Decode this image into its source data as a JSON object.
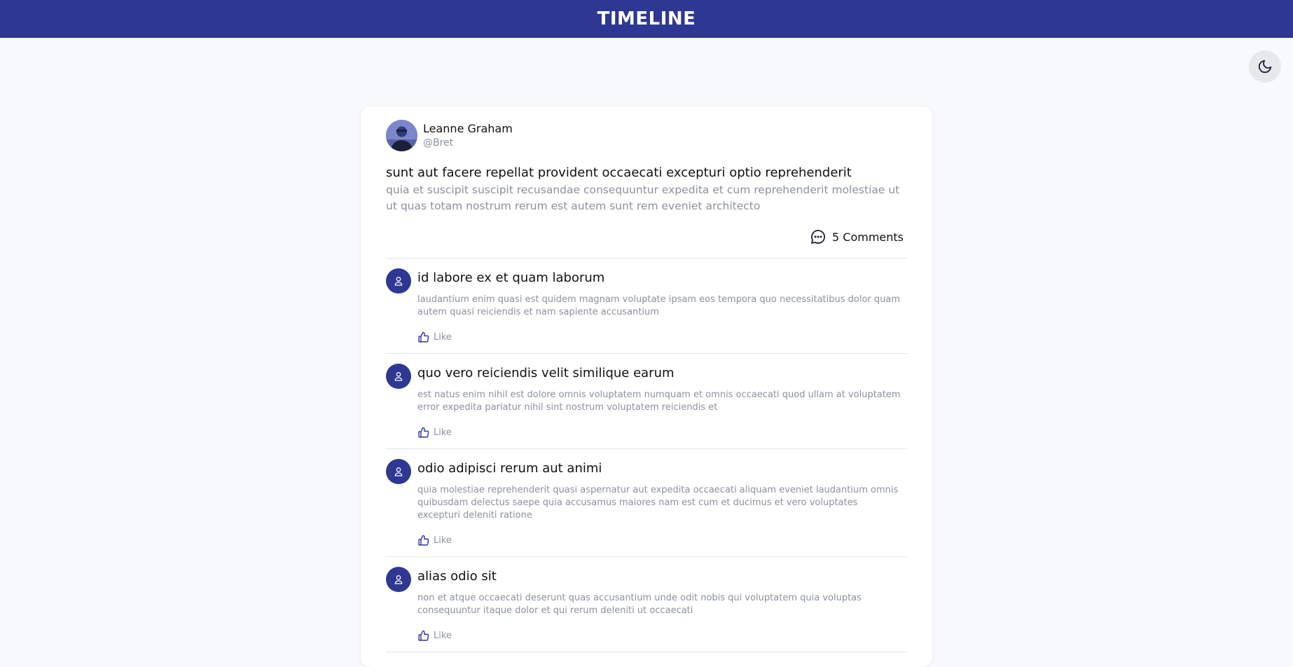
{
  "header": {
    "title": "TIMELINE"
  },
  "theme_toggle": {
    "icon": "moon-icon"
  },
  "post": {
    "author": {
      "name": "Leanne Graham",
      "handle": "@Bret"
    },
    "title": "sunt aut facere repellat provident occaecati excepturi optio reprehenderit",
    "body": "quia et suscipit suscipit recusandae consequuntur expedita et cum reprehenderit molestiae ut ut quas totam nostrum rerum est autem sunt rem eveniet architecto",
    "comments_label": "5 Comments"
  },
  "comments": [
    {
      "title": "id labore ex et quam laborum",
      "body": "laudantium enim quasi est quidem magnam voluptate ipsam eos tempora quo necessitatibus dolor quam autem quasi reiciendis et nam sapiente accusantium",
      "like_label": "Like"
    },
    {
      "title": "quo vero reiciendis velit similique earum",
      "body": "est natus enim nihil est dolore omnis voluptatem numquam et omnis occaecati quod ullam at voluptatem error expedita pariatur nihil sint nostrum voluptatem reiciendis et",
      "like_label": "Like"
    },
    {
      "title": "odio adipisci rerum aut animi",
      "body": "quia molestiae reprehenderit quasi aspernatur aut expedita occaecati aliquam eveniet laudantium omnis quibusdam delectus saepe quia accusamus maiores nam est cum et ducimus et vero voluptates excepturi deleniti ratione",
      "like_label": "Like"
    },
    {
      "title": "alias odio sit",
      "body": "non et atque occaecati deserunt quas accusantium unde odit nobis qui voluptatem quia voluptas consequuntur itaque dolor et qui rerum deleniti ut occaecati",
      "like_label": "Like"
    }
  ],
  "colors": {
    "header_bg": "#2e3791",
    "accent": "#2e3791",
    "muted_text": "#8c919c",
    "page_bg": "#f8f9fc"
  }
}
